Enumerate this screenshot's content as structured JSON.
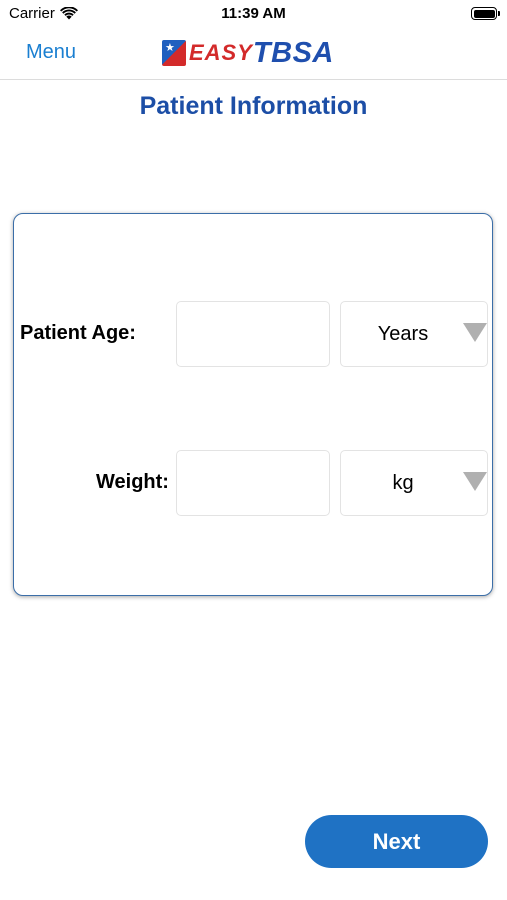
{
  "status_bar": {
    "carrier": "Carrier",
    "time": "11:39 AM"
  },
  "nav": {
    "menu_label": "Menu",
    "logo_easy": "EASY",
    "logo_tbsa": "TBSA"
  },
  "page": {
    "title": "Patient Information"
  },
  "form": {
    "age": {
      "label": "Patient Age:",
      "value": "",
      "unit": "Years"
    },
    "weight": {
      "label": "Weight:",
      "value": "",
      "unit": "kg"
    }
  },
  "actions": {
    "next_label": "Next"
  },
  "colors": {
    "accent": "#1f72c4",
    "title": "#1c4ea6",
    "card_border": "#3b6ea8"
  }
}
